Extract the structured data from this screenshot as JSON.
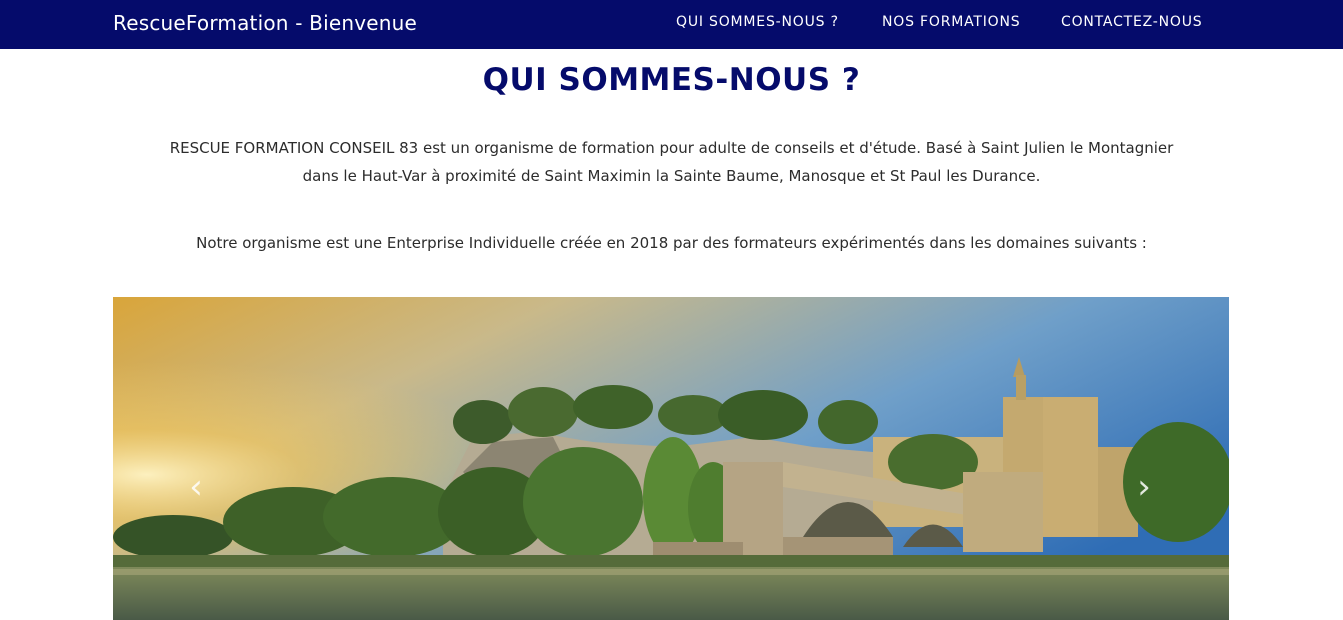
{
  "navbar": {
    "brand": "RescueFormation - Bienvenue",
    "links": [
      {
        "label": "QUI SOMMES-NOUS ?"
      },
      {
        "label": "NOS FORMATIONS"
      },
      {
        "label": "CONTACTEZ-NOUS"
      }
    ],
    "background_color": "#050b6b"
  },
  "section": {
    "title": "QUI SOMMES-NOUS ?",
    "paragraph_line1": "RESCUE FORMATION CONSEIL 83 est un organisme de formation pour adulte de conseils et d'étude. Basé à Saint Julien le Montagnier",
    "paragraph_line2": "dans le Haut-Var à proximité de Saint Maximin la Sainte Baume, Manosque et St Paul les Durance.",
    "paragraph2": "Notre organisme est une Enterprise Individuelle créée en 2018 par des formateurs expérimentés dans les domaines suivants :"
  },
  "carousel": {
    "prev_icon": "chevron-left-icon",
    "next_icon": "chevron-right-icon",
    "prev_glyph": "‹",
    "next_glyph": "›"
  }
}
